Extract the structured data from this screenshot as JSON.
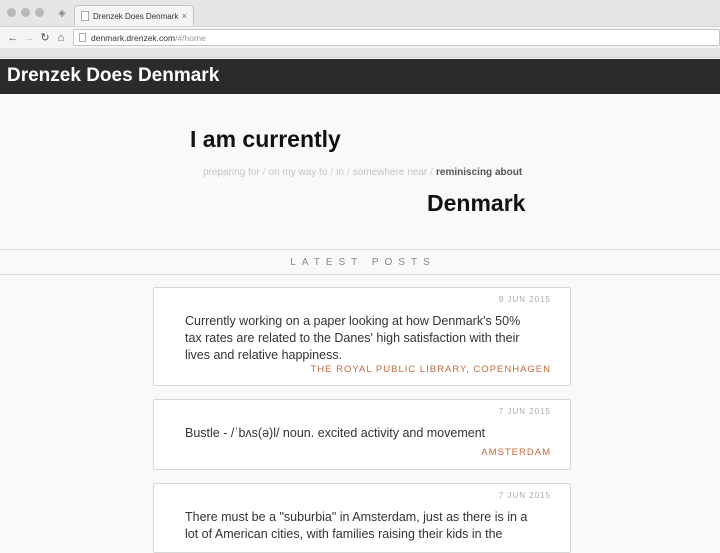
{
  "browser": {
    "tab_title": "Drenzek Does Denmark",
    "tab_close": "×",
    "url_domain": "denmark.drenzek.com",
    "url_path": "/#/home"
  },
  "site": {
    "title": "Drenzek Does Denmark"
  },
  "hero": {
    "line1": "I am currently",
    "options": [
      "preparing for",
      "on my way to",
      "in",
      "somewhere near",
      "reminiscing about"
    ],
    "separator": "/",
    "active_option": "reminiscing about",
    "place": "Denmark"
  },
  "latest": {
    "label": "LATEST POSTS",
    "posts": [
      {
        "date": "9 JUN 2015",
        "body": "Currently working on a paper looking at how Denmark's 50% tax rates are related to the Danes' high satisfaction with their lives and relative happiness.",
        "location": "THE ROYAL PUBLIC LIBRARY, COPENHAGEN"
      },
      {
        "date": "7 JUN 2015",
        "body": "Bustle - /ˈbʌs(ə)l/ noun. excited activity and movement",
        "location": "AMSTERDAM"
      },
      {
        "date": "7 JUN 2015",
        "body": "There must be a \"suburbia\" in Amsterdam, just as there is in a lot of American cities, with families raising their kids in the",
        "location": ""
      }
    ]
  }
}
